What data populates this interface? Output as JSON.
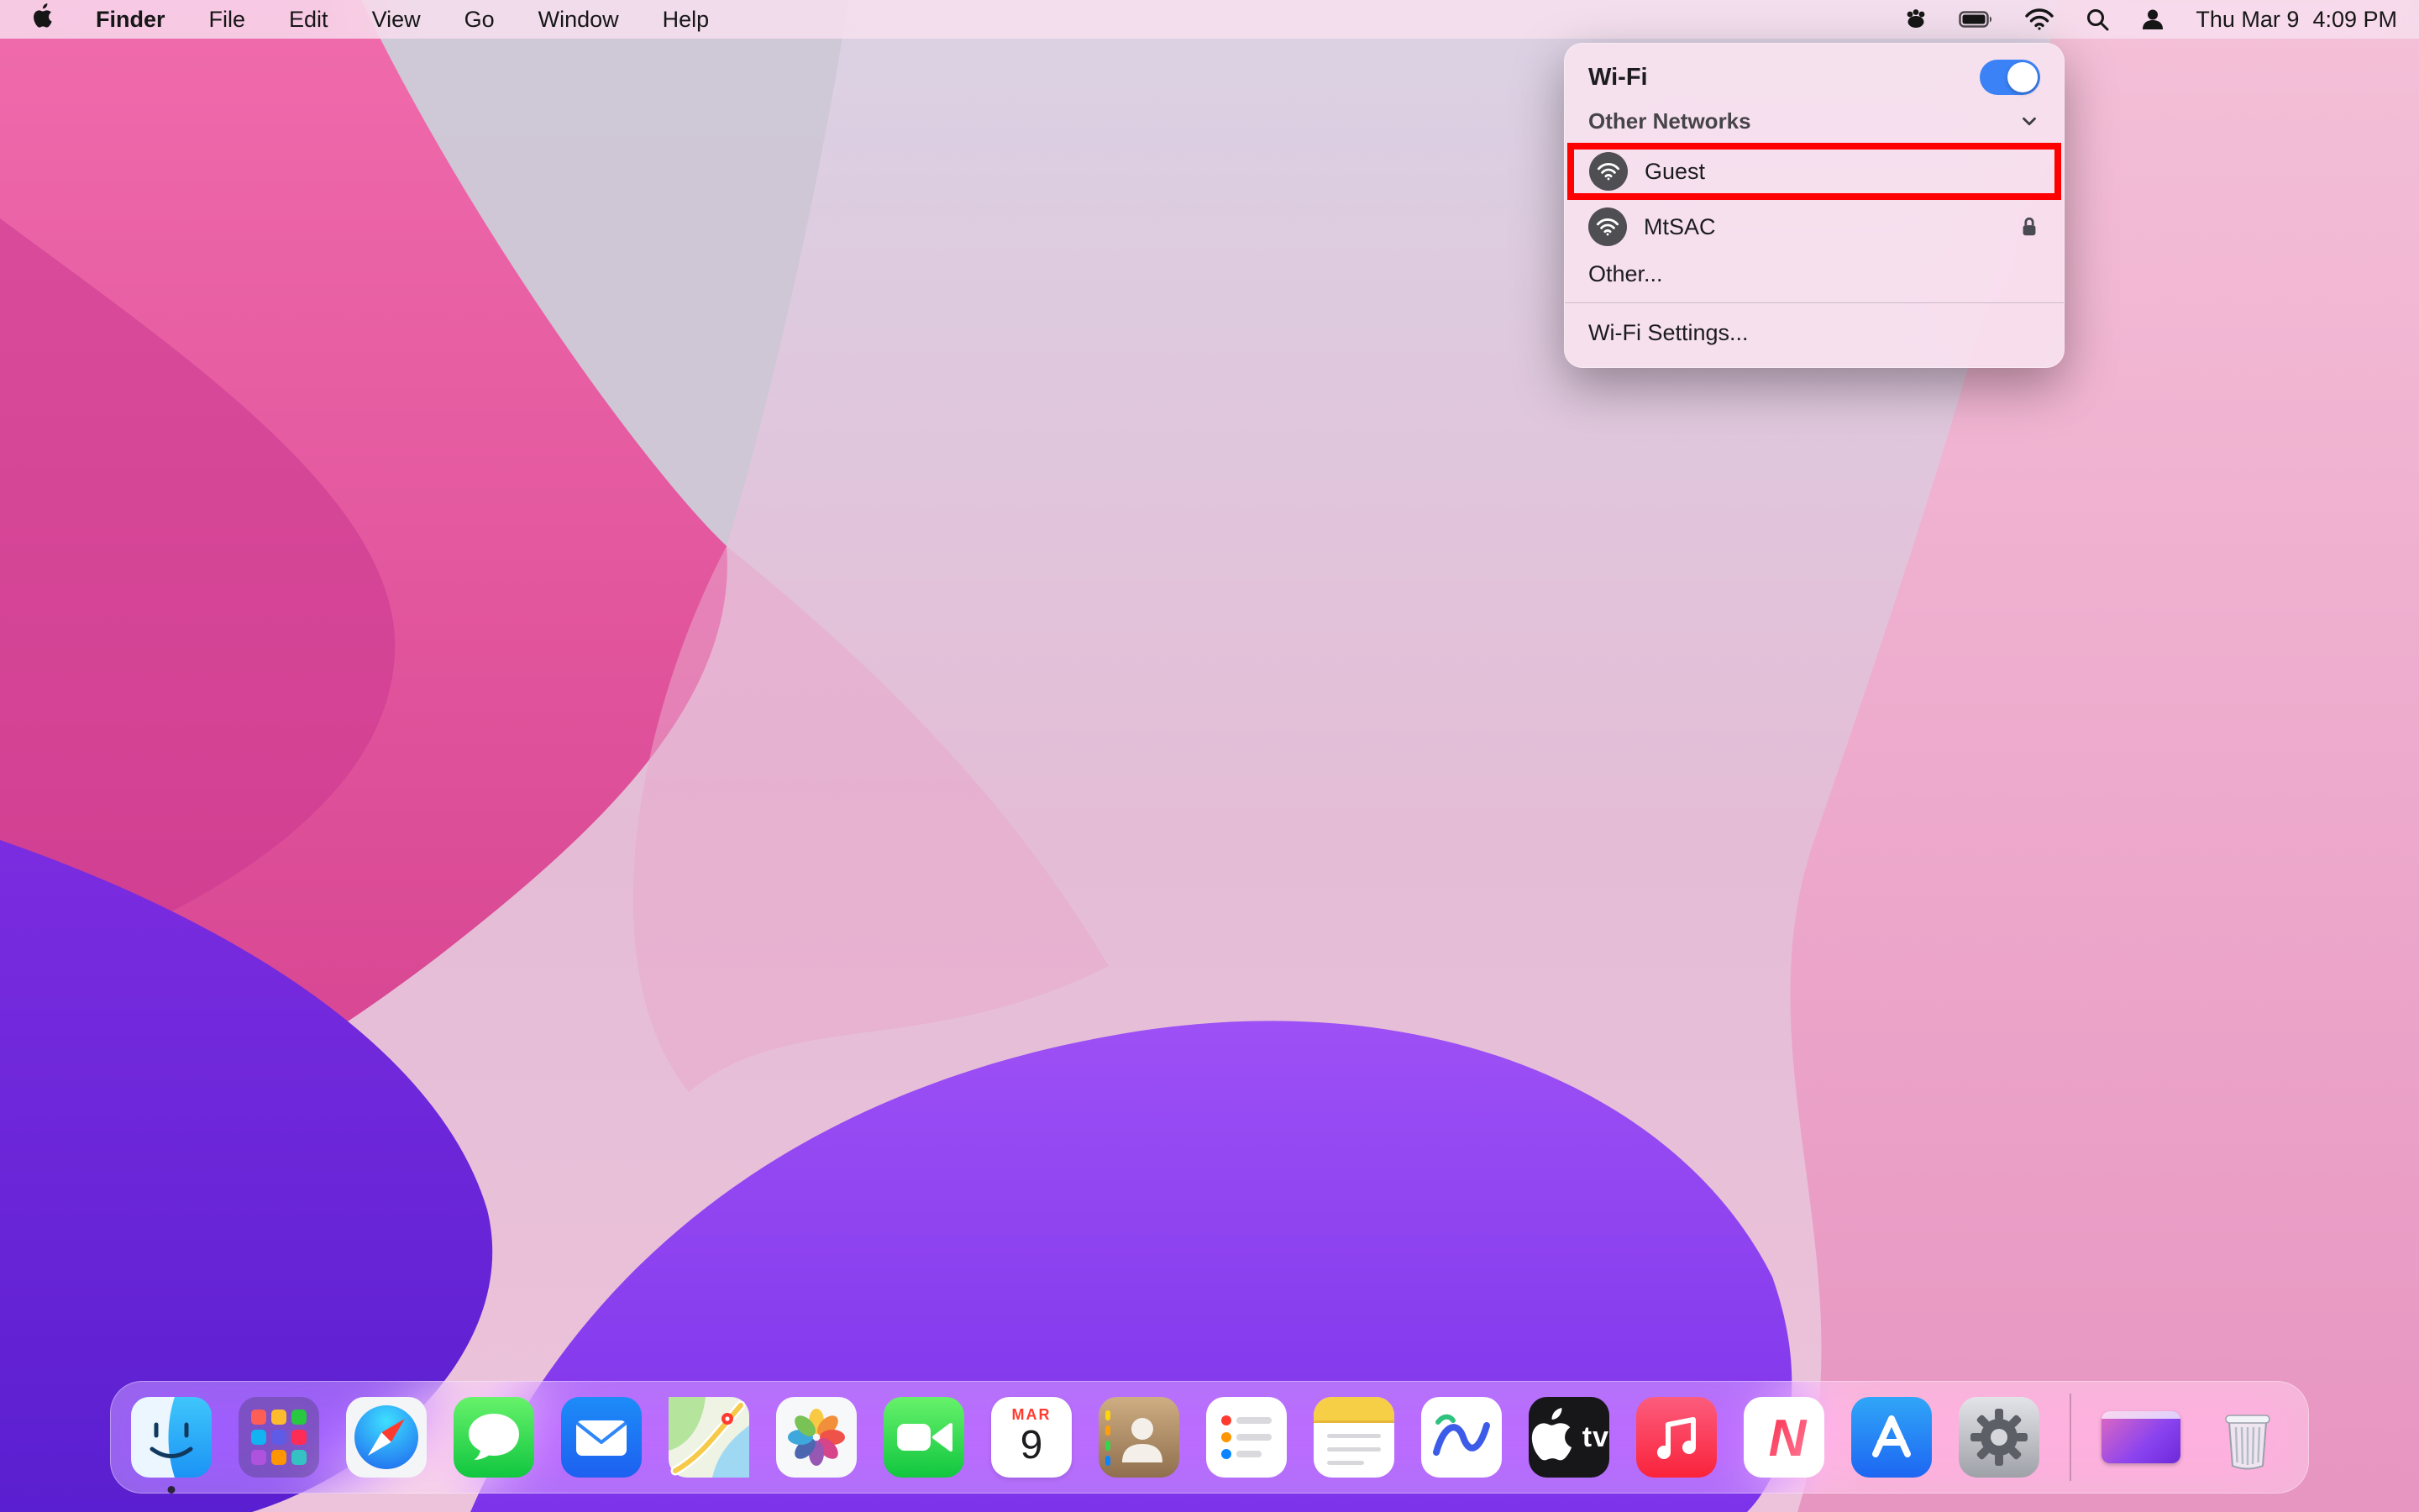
{
  "menu_bar": {
    "app_name": "Finder",
    "menus": [
      "File",
      "Edit",
      "View",
      "Go",
      "Window",
      "Help"
    ],
    "status_icons": [
      "menu-extra-icon",
      "battery-icon",
      "wifi-icon",
      "spotlight-icon",
      "user-icon"
    ],
    "date": "Thu Mar 9",
    "time": "4:09 PM"
  },
  "wifi_menu": {
    "title": "Wi-Fi",
    "wifi_enabled": true,
    "section_header": "Other Networks",
    "networks": [
      {
        "name": "Guest",
        "secured": false,
        "annotated": true
      },
      {
        "name": "MtSAC",
        "secured": true,
        "annotated": false
      }
    ],
    "other_label": "Other...",
    "settings_label": "Wi-Fi Settings...",
    "toggle_color": "#3B82F7",
    "annotation_color": "#FF0000"
  },
  "dock": {
    "items": [
      "finder",
      "launchpad",
      "safari",
      "messages",
      "mail",
      "maps",
      "photos",
      "facetime",
      "calendar",
      "contacts",
      "reminders",
      "notes",
      "freeform",
      "apple-tv",
      "music",
      "news",
      "app-store",
      "system-settings",
      "window-preview",
      "trash"
    ],
    "calendar": {
      "month": "MAR",
      "day": "9"
    },
    "apple_tv_label": "tv"
  }
}
